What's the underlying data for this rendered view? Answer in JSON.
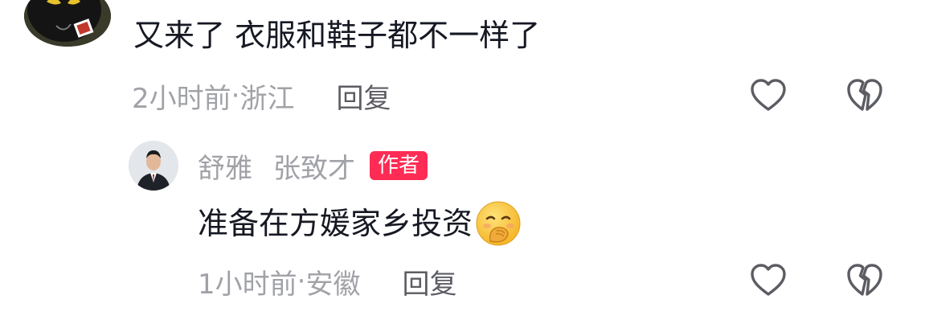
{
  "comments": [
    {
      "text": "又来了 衣服和鞋子都不一样了",
      "time": "2小时前",
      "location": "浙江",
      "reply_label": "回复",
      "avatar": "black-cat-avatar"
    }
  ],
  "reply": {
    "username": "舒雅",
    "reply_to": "张致才",
    "badge": "作者",
    "text": "准备在方媛家乡投资",
    "emoji": "face-with-hand-over-mouth-emoji",
    "time": "1小时前",
    "location": "安徽",
    "reply_label": "回复",
    "avatar": "man-in-suit-avatar"
  },
  "meta_separator": " · ",
  "icons": {
    "like": "heart-outline-icon",
    "dislike": "broken-heart-outline-icon"
  },
  "colors": {
    "text_primary": "#161823",
    "text_secondary": "#a1a2a7",
    "reply_button": "#5c5d63",
    "badge_bg": "#fe2c55"
  }
}
